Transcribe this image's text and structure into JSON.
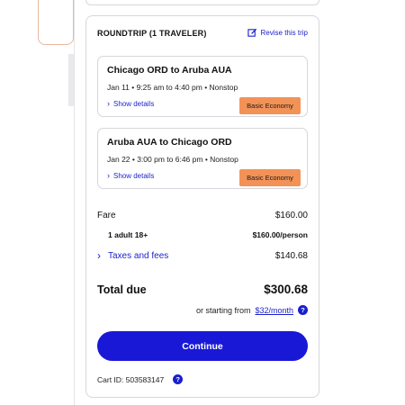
{
  "trip": {
    "title": "ROUNDTRIP (1 TRAVELER)",
    "revise_label": "Revise this trip"
  },
  "legs": [
    {
      "route": "Chicago ORD to Aruba AUA",
      "time": "Jan 11 • 9:25 am to 4:40 pm • Nonstop",
      "details_label": "Show details",
      "fare_class": "Basic Economy"
    },
    {
      "route": "Aruba AUA to Chicago ORD",
      "time": "Jan 22 • 3:00 pm to 6:46 pm • Nonstop",
      "details_label": "Show details",
      "fare_class": "Basic Economy"
    }
  ],
  "pricing": {
    "fare_label": "Fare",
    "fare_value": "$160.00",
    "traveler_label": "1 adult 18+",
    "traveler_value": "$160.00/person",
    "taxes_label": "Taxes and fees",
    "taxes_value": "$140.68",
    "total_label": "Total due",
    "total_value": "$300.68",
    "monthly_prefix": "or starting from",
    "monthly_link": "$32/month"
  },
  "actions": {
    "continue_label": "Continue"
  },
  "cart": {
    "id_text": "Cart ID: 503583147"
  },
  "colors": {
    "accent": "#1818d6",
    "link": "#1a1fcb",
    "badge": "#f39257"
  }
}
